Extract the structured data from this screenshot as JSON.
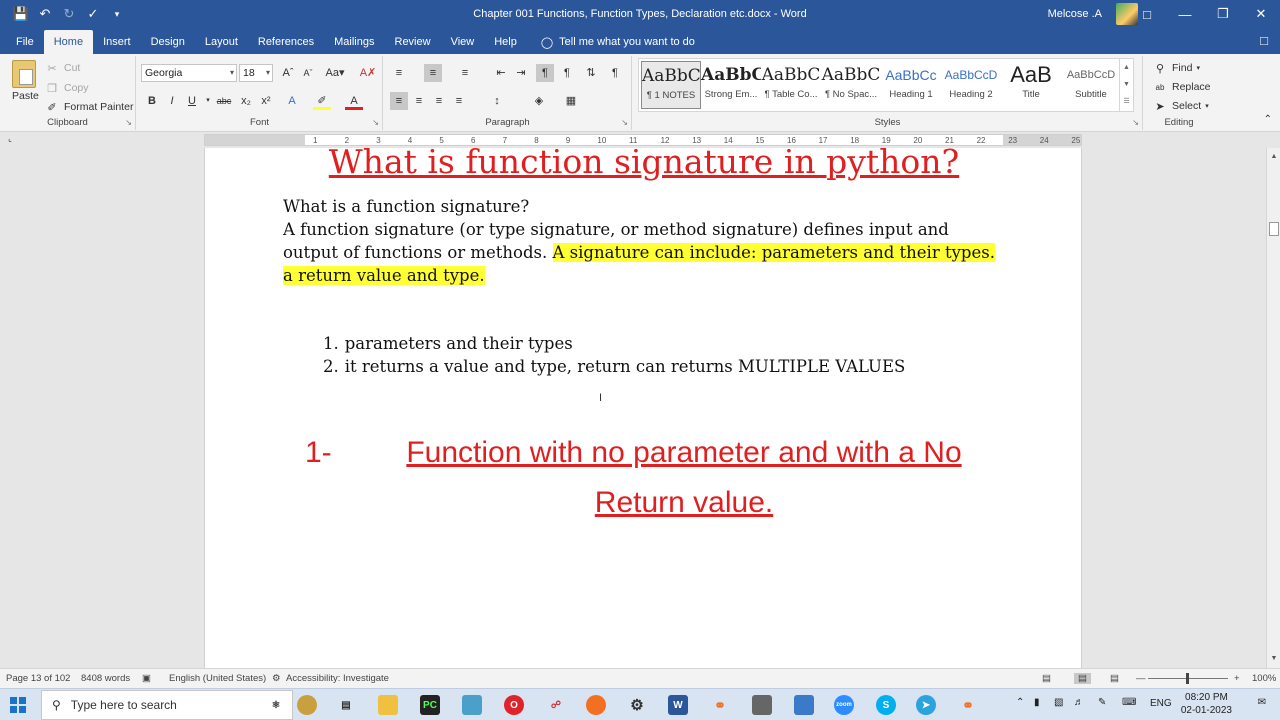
{
  "window": {
    "title": "Chapter 001 Functions, Function Types, Declaration etc.docx  -  Word",
    "user": "Melcose .A"
  },
  "tabs": [
    "File",
    "Home",
    "Insert",
    "Design",
    "Layout",
    "References",
    "Mailings",
    "Review",
    "View",
    "Help"
  ],
  "tell_me": "Tell me what you want to do",
  "clipboard": {
    "paste": "Paste",
    "cut": "Cut",
    "copy": "Copy",
    "format_painter": "Format Painter",
    "label": "Clipboard"
  },
  "font": {
    "name": "Georgia",
    "size": "18",
    "label": "Font"
  },
  "paragraph": {
    "label": "Paragraph"
  },
  "styles": {
    "label": "Styles",
    "items": [
      {
        "preview": "AaBbC",
        "name": "¶ 1 NOTES"
      },
      {
        "preview": "AaBbC",
        "name": "Strong Em..."
      },
      {
        "preview": "AaBbC",
        "name": "¶ Table Co..."
      },
      {
        "preview": "AaBbC",
        "name": "¶ No Spac..."
      },
      {
        "preview": "AaBbCc",
        "name": "Heading 1"
      },
      {
        "preview": "AaBbCcD",
        "name": "Heading 2"
      },
      {
        "preview": "AaB",
        "name": "Title"
      },
      {
        "preview": "AaBbCcD",
        "name": "Subtitle"
      }
    ]
  },
  "editing": {
    "find": "Find",
    "replace": "Replace",
    "select": "Select",
    "label": "Editing"
  },
  "ruler": {
    "ticks": [
      "1",
      "2",
      "3",
      "4",
      "5",
      "6",
      "7",
      "8",
      "9",
      "10",
      "11",
      "12",
      "13",
      "14",
      "15",
      "16",
      "17",
      "18",
      "19",
      "20",
      "21",
      "22",
      "23",
      "24",
      "25"
    ]
  },
  "document": {
    "heading": "What is function signature in python?",
    "question": "What is a function signature?",
    "para_plain": "A function signature (or type signature, or method signature) defines input and output of functions or methods. ",
    "para_highlight": "A signature can include: parameters and their types. a return value and type.",
    "list": [
      {
        "num": "1.",
        "text": "parameters and their types"
      },
      {
        "num": "2.",
        "text": "it returns a value and type, return can returns MULTIPLE VALUES"
      }
    ],
    "section_num": "1-",
    "section_title": "Function with no parameter and with a No Return value."
  },
  "status": {
    "page": "Page 13 of 102",
    "words": "8408 words",
    "language": "English (United States)",
    "accessibility": "Accessibility: Investigate",
    "zoom": "100%"
  },
  "taskbar": {
    "search_placeholder": "Type here to search",
    "lang": "ENG",
    "time": "08:20 PM",
    "date": "02-01-2023"
  },
  "colors": {
    "accent": "#2b579a",
    "heading_red": "#e02020",
    "highlight": "#ffff33"
  }
}
